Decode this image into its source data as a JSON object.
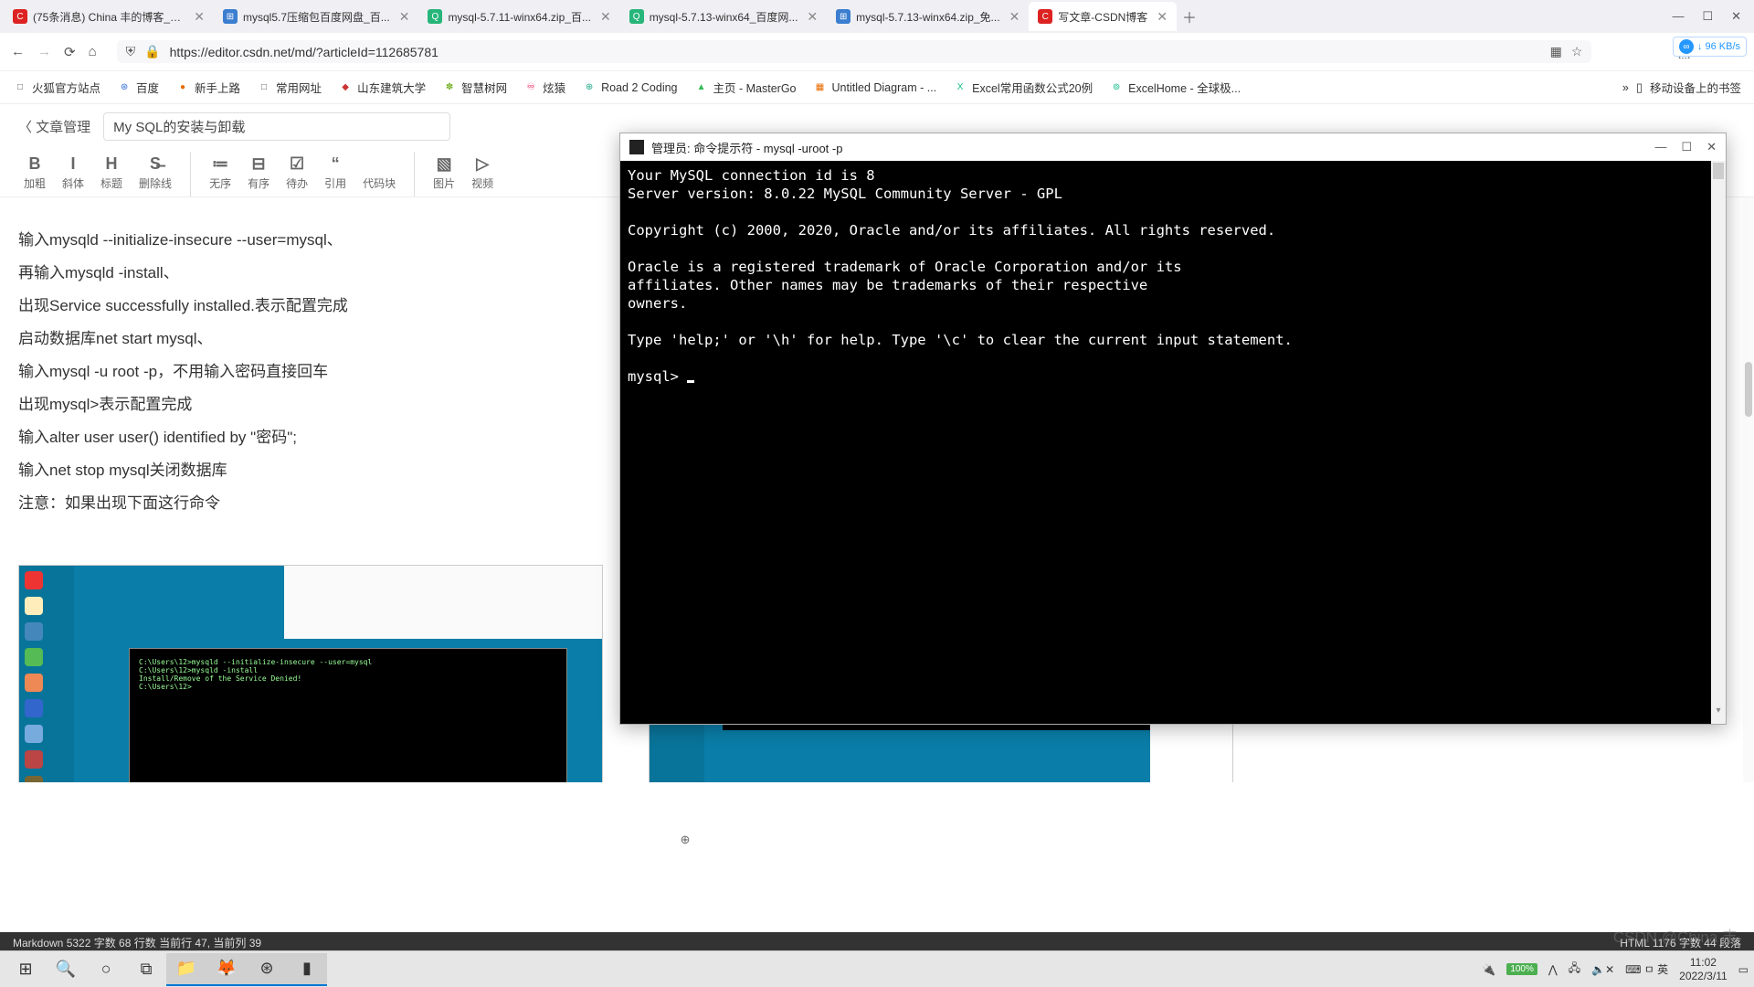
{
  "browser": {
    "tabs": [
      {
        "title": "(75条消息) China 丰的博客_C...",
        "fav": "C",
        "favbg": "#d22"
      },
      {
        "title": "mysql5.7压缩包百度网盘_百...",
        "fav": "⊞",
        "favbg": "#3b7ed0"
      },
      {
        "title": "mysql-5.7.11-winx64.zip_百...",
        "fav": "Q",
        "favbg": "#27b57a"
      },
      {
        "title": "mysql-5.7.13-winx64_百度网...",
        "fav": "Q",
        "favbg": "#27b57a"
      },
      {
        "title": "mysql-5.7.13-winx64.zip_免...",
        "fav": "⊞",
        "favbg": "#3b7ed0"
      },
      {
        "title": "写文章-CSDN博客",
        "fav": "C",
        "favbg": "#d22",
        "active": true
      }
    ],
    "newtab": "＋",
    "wins": [
      "—",
      "☐",
      "✕"
    ],
    "netspeed": "↓ 96 KB/s",
    "nav": {
      "back": "←",
      "fwd": "→",
      "reload": "⟳",
      "home": "⌂"
    },
    "url": "https://editor.csdn.net/md/?articleId=112685781",
    "urlicons": [
      "⛨",
      "🔒"
    ],
    "urlright": [
      "▦",
      "☆"
    ],
    "right": [
      "⬚",
      "↩",
      "≡"
    ],
    "bookmarks": [
      {
        "t": "火狐官方站点",
        "c": "#555",
        "i": "□"
      },
      {
        "t": "百度",
        "c": "#2d6bd8",
        "i": "⊛"
      },
      {
        "t": "新手上路",
        "c": "#e66a00",
        "i": "●"
      },
      {
        "t": "常用网址",
        "c": "#555",
        "i": "□"
      },
      {
        "t": "山东建筑大学",
        "c": "#c33",
        "i": "◆"
      },
      {
        "t": "智慧树网",
        "c": "#7ab42c",
        "i": "✽"
      },
      {
        "t": "炫猿",
        "c": "#e04",
        "i": "♾"
      },
      {
        "t": "Road 2 Coding",
        "c": "#2a8",
        "i": "⊕"
      },
      {
        "t": "主页 - MasterGo",
        "c": "#3b5",
        "i": "▲"
      },
      {
        "t": "Untitled Diagram - ...",
        "c": "#e66a00",
        "i": "▦"
      },
      {
        "t": "Excel常用函数公式20例",
        "c": "#1b8",
        "i": "X"
      },
      {
        "t": "ExcelHome - 全球极...",
        "c": "#1b8",
        "i": "⊚"
      }
    ],
    "bmright": {
      "more": "»",
      "mobile": "移动设备上的书签"
    }
  },
  "editor": {
    "back": "〈 文章管理",
    "title": "My SQL的安装与卸载",
    "toolbar": [
      {
        "ic": "B",
        "l": "加粗"
      },
      {
        "ic": "I",
        "l": "斜体"
      },
      {
        "ic": "H",
        "l": "标题"
      },
      {
        "ic": "S̶",
        "l": "删除线"
      },
      {
        "ic": "≔",
        "l": "无序"
      },
      {
        "ic": "⊟",
        "l": "有序"
      },
      {
        "ic": "☑",
        "l": "待办"
      },
      {
        "ic": "“",
        "l": "引用"
      },
      {
        "ic": "</>",
        "l": "代码块"
      },
      {
        "ic": "▧",
        "l": "图片"
      },
      {
        "ic": "▷",
        "l": "视频"
      }
    ],
    "body": [
      "输入mysqld --initialize-insecure --user=mysql、",
      "再输入mysqld -install、",
      "出现Service successfully installed.表示配置完成",
      "启动数据库net start mysql、",
      "输入mysql -u root -p，不用输入密码直接回车",
      "出现mysql>表示配置完成",
      "输入alter user user() identified by \"密码\";",
      "输入net stop mysql关闭数据库",
      "注意：如果出现下面这行命令"
    ],
    "status_left": "Markdown  5322 字数  68 行数  当前行 47, 当前列 39",
    "status_right": "HTML  1176 字数  44 段落"
  },
  "terminal": {
    "title": "管理员: 命令提示符 - mysql  -uroot -p",
    "controls": [
      "—",
      "☐",
      "✕"
    ],
    "lines": [
      "Your MySQL connection id is 8",
      "Server version: 8.0.22 MySQL Community Server - GPL",
      "",
      "Copyright (c) 2000, 2020, Oracle and/or its affiliates. All rights reserved.",
      "",
      "Oracle is a registered trademark of Oracle Corporation and/or its",
      "affiliates. Other names may be trademarks of their respective",
      "owners.",
      "",
      "Type 'help;' or '\\h' for help. Type '\\c' to clear the current input statement.",
      "",
      "mysql> "
    ]
  },
  "taskbar": {
    "items": [
      "⊞",
      "🔍",
      "○",
      "⧉",
      "📁",
      "🦊",
      "⊛",
      "▮"
    ],
    "active": [
      4,
      5,
      6,
      7
    ],
    "tray": {
      "batt": "100%",
      "ime": "⌨ ㅁ 英",
      "time": "11:02",
      "date": "2022/3/11"
    }
  },
  "watermark": "CSDN @China 丰"
}
